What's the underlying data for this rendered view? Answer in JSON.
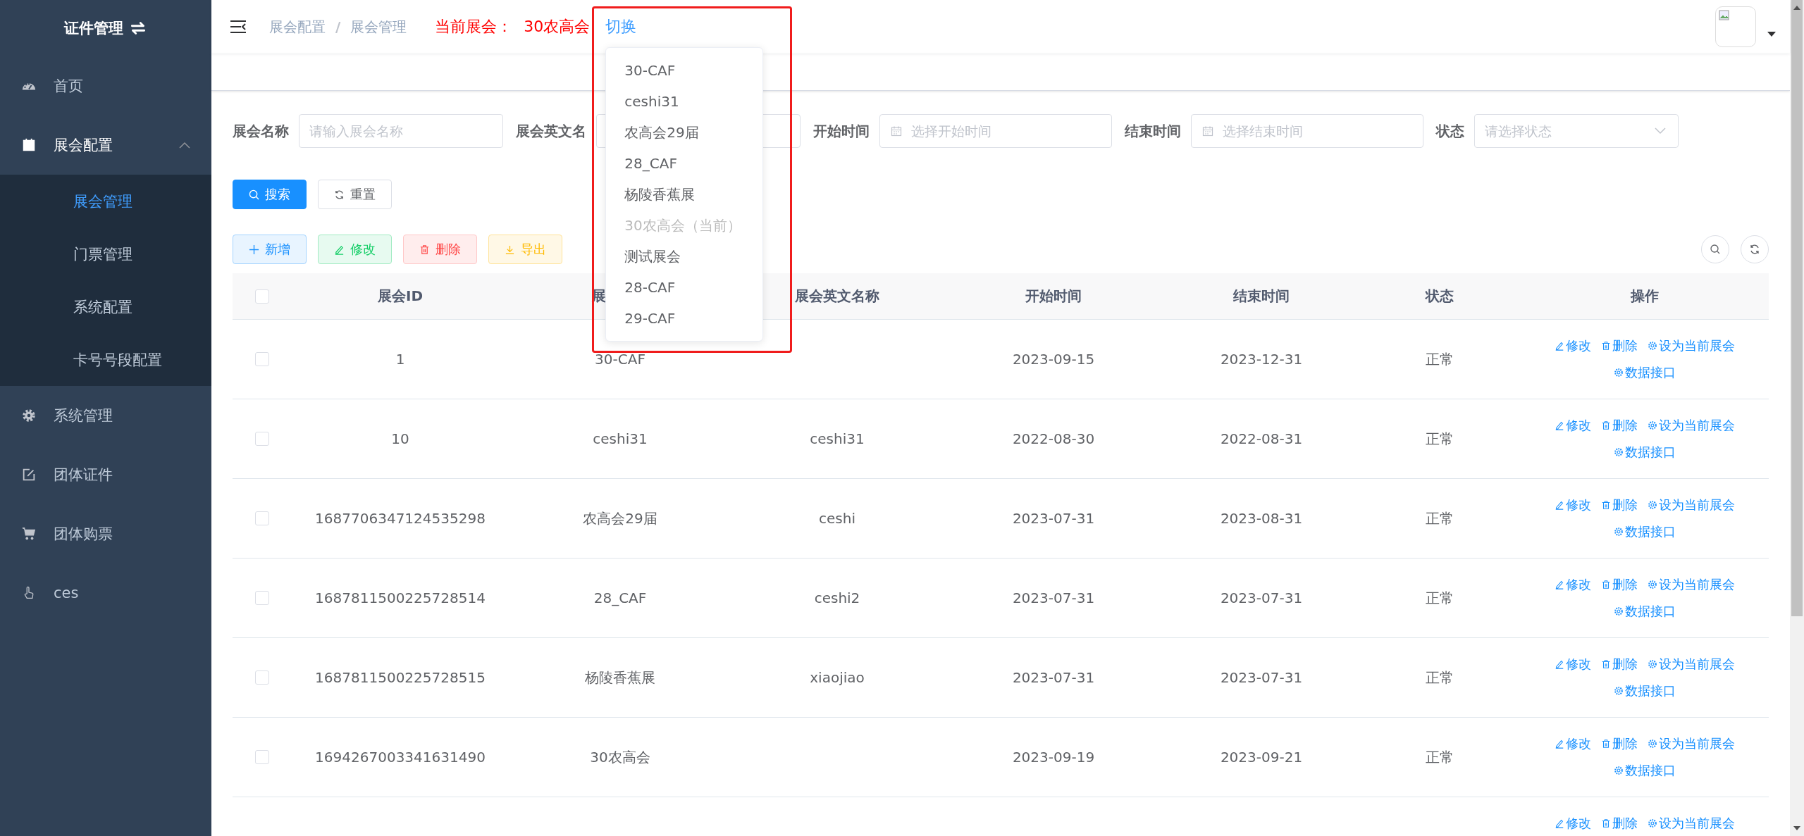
{
  "sidebar": {
    "title": "证件管理",
    "menu": [
      {
        "label": "首页"
      },
      {
        "label": "展会配置",
        "expanded": true,
        "children": [
          {
            "label": "展会管理",
            "selected": true
          },
          {
            "label": "门票管理",
            "selected": false
          },
          {
            "label": "系统配置",
            "selected": false
          },
          {
            "label": "卡号号段配置",
            "selected": false
          }
        ]
      },
      {
        "label": "系统管理",
        "expanded": false
      },
      {
        "label": "团体证件",
        "expanded": false
      },
      {
        "label": "团体购票",
        "expanded": false
      },
      {
        "label": "ces"
      }
    ]
  },
  "header": {
    "breadcrumb": [
      "展会配置",
      "展会管理"
    ],
    "breadcrumb_separator": "/",
    "current_label": "当前展会：",
    "current_value": "30农高会",
    "switch_link": "切换",
    "dropdown": [
      {
        "label": "30-CAF",
        "disabled": false
      },
      {
        "label": "ceshi31",
        "disabled": false
      },
      {
        "label": "农高会29届",
        "disabled": false
      },
      {
        "label": "28_CAF",
        "disabled": false
      },
      {
        "label": "杨陵香蕉展",
        "disabled": false
      },
      {
        "label": "30农高会（当前）",
        "disabled": true
      },
      {
        "label": "测试展会",
        "disabled": false
      },
      {
        "label": "28-CAF",
        "disabled": false
      },
      {
        "label": "29-CAF",
        "disabled": false
      }
    ]
  },
  "filters": [
    {
      "kind": "text",
      "label": "展会名称",
      "placeholder": "请输入展会名称"
    },
    {
      "kind": "text",
      "label": "展会英文名"
    },
    {
      "kind": "date",
      "label": "开始时间",
      "placeholder": "选择开始时间"
    },
    {
      "kind": "date",
      "label": "结束时间",
      "placeholder": "选择结束时间"
    },
    {
      "kind": "select",
      "label": "状态",
      "placeholder": "请选择状态"
    }
  ],
  "search_buttons": [
    {
      "kind": "search",
      "label": "搜索"
    },
    {
      "kind": "reset",
      "label": "重置"
    }
  ],
  "toolbar": [
    {
      "kind": "add",
      "label": "新增"
    },
    {
      "kind": "edit",
      "label": "修改"
    },
    {
      "kind": "delete",
      "label": "删除"
    },
    {
      "kind": "export",
      "label": "导出"
    }
  ],
  "table": {
    "header_checked": false,
    "columns": [
      "展会ID",
      "展",
      "展会英文名称",
      "开始时间",
      "结束时间",
      "状态",
      "操作"
    ],
    "rows": [
      {
        "checked": false,
        "cells": [
          "1",
          "30-CAF",
          "",
          "2023-09-15",
          "2023-12-31",
          "正常"
        ],
        "actions": [
          "修改",
          "删除",
          "设为当前展会",
          "数据接口"
        ]
      },
      {
        "checked": false,
        "cells": [
          "10",
          "ceshi31",
          "ceshi31",
          "2022-08-30",
          "2022-08-31",
          "正常"
        ],
        "actions": [
          "修改",
          "删除",
          "设为当前展会",
          "数据接口"
        ]
      },
      {
        "checked": false,
        "cells": [
          "1687706347124535298",
          "农高会29届",
          "ceshi",
          "2023-07-31",
          "2023-08-31",
          "正常"
        ],
        "actions": [
          "修改",
          "删除",
          "设为当前展会",
          "数据接口"
        ]
      },
      {
        "checked": false,
        "cells": [
          "1687811500225728514",
          "28_CAF",
          "ceshi2",
          "2023-07-31",
          "2023-07-31",
          "正常"
        ],
        "actions": [
          "修改",
          "删除",
          "设为当前展会",
          "数据接口"
        ]
      },
      {
        "checked": false,
        "cells": [
          "1687811500225728515",
          "杨陵香蕉展",
          "xiaojiao",
          "2023-07-31",
          "2023-07-31",
          "正常"
        ],
        "actions": [
          "修改",
          "删除",
          "设为当前展会",
          "数据接口"
        ]
      },
      {
        "checked": false,
        "cells": [
          "1694267003341631490",
          "30农高会",
          "",
          "2023-09-19",
          "2023-09-21",
          "正常"
        ],
        "actions": [
          "修改",
          "删除",
          "设为当前展会",
          "数据接口"
        ]
      },
      {
        "actions": [
          "修改",
          "删除",
          "设为当前展会"
        ]
      }
    ]
  }
}
